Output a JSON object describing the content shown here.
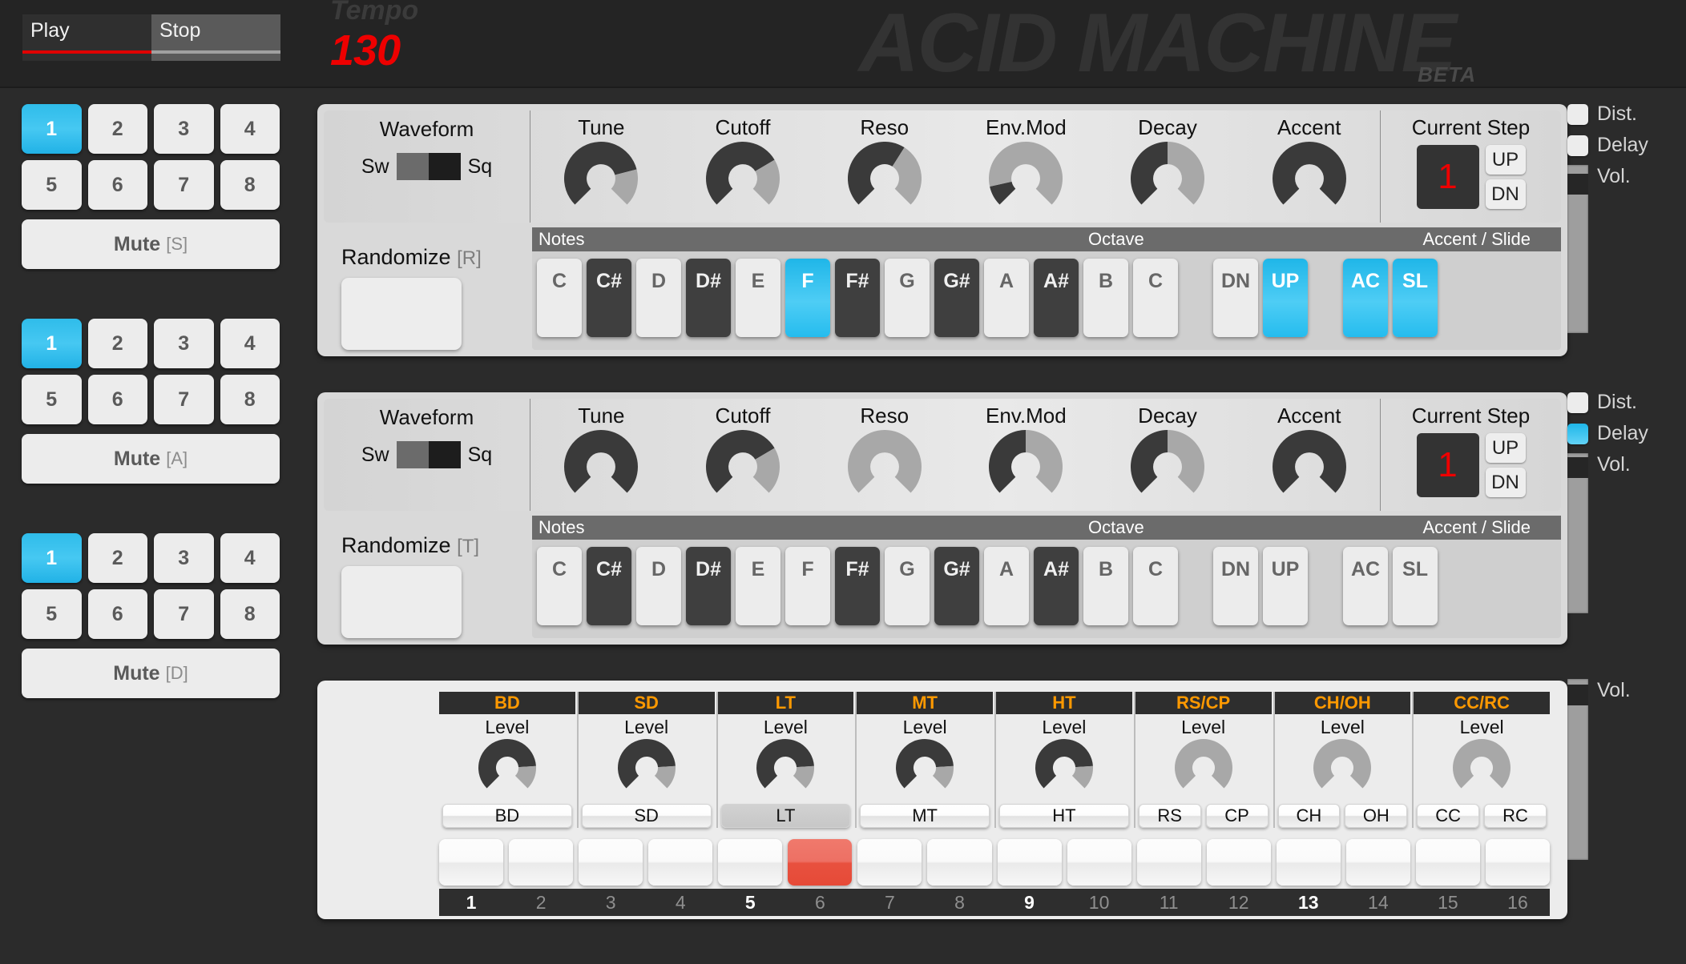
{
  "header": {
    "logo": "ACID MACHINE",
    "beta": "BETA",
    "play_label": "Play",
    "stop_label": "Stop",
    "tempo_label": "Tempo",
    "tempo_value": "130"
  },
  "colors": {
    "accent_blue": "#21b6e8",
    "accent_red": "#ee0000",
    "track_orange": "#ff9900",
    "step_red": "#e8513f"
  },
  "patterns": {
    "buttons": [
      "1",
      "2",
      "3",
      "4",
      "5",
      "6",
      "7",
      "8"
    ],
    "blocks": [
      {
        "active_index": 0,
        "mute_label": "Mute",
        "mute_key": "[S]"
      },
      {
        "active_index": 0,
        "mute_label": "Mute",
        "mute_key": "[A]"
      },
      {
        "active_index": 0,
        "mute_label": "Mute",
        "mute_key": "[D]"
      }
    ]
  },
  "synths": [
    {
      "waveform": {
        "title": "Waveform",
        "left_label": "Sw",
        "right_label": "Sq",
        "value": "Sq"
      },
      "knobs": [
        {
          "label": "Tune",
          "value": 78
        },
        {
          "label": "Cutoff",
          "value": 72
        },
        {
          "label": "Reso",
          "value": 62
        },
        {
          "label": "Env.Mod",
          "value": 12
        },
        {
          "label": "Decay",
          "value": 50
        },
        {
          "label": "Accent",
          "value": 100
        }
      ],
      "current_step": {
        "title": "Current Step",
        "value": "1",
        "up_label": "UP",
        "down_label": "DN"
      },
      "randomize": {
        "label": "Randomize",
        "key": "[R]"
      },
      "notes_header": {
        "notes": "Notes",
        "octave": "Octave",
        "accent": "Accent / Slide"
      },
      "keys": [
        {
          "name": "C",
          "type": "white",
          "on": false
        },
        {
          "name": "C#",
          "type": "black",
          "on": false
        },
        {
          "name": "D",
          "type": "white",
          "on": false
        },
        {
          "name": "D#",
          "type": "black",
          "on": false
        },
        {
          "name": "E",
          "type": "white",
          "on": false
        },
        {
          "name": "F",
          "type": "white",
          "on": true
        },
        {
          "name": "F#",
          "type": "black",
          "on": false
        },
        {
          "name": "G",
          "type": "white",
          "on": false
        },
        {
          "name": "G#",
          "type": "black",
          "on": false
        },
        {
          "name": "A",
          "type": "white",
          "on": false
        },
        {
          "name": "A#",
          "type": "black",
          "on": false
        },
        {
          "name": "B",
          "type": "white",
          "on": false
        },
        {
          "name": "C",
          "type": "white",
          "on": false
        }
      ],
      "octave": [
        {
          "name": "DN",
          "on": false
        },
        {
          "name": "UP",
          "on": true
        }
      ],
      "accent_slide": [
        {
          "name": "AC",
          "on": true
        },
        {
          "name": "SL",
          "on": true
        }
      ],
      "fx": {
        "dist_label": "Dist.",
        "dist_on": false,
        "delay_label": "Delay",
        "delay_on": false,
        "vol_label": "Vol.",
        "vol": 88
      }
    },
    {
      "waveform": {
        "title": "Waveform",
        "left_label": "Sw",
        "right_label": "Sq",
        "value": "Sq"
      },
      "knobs": [
        {
          "label": "Tune",
          "value": 100
        },
        {
          "label": "Cutoff",
          "value": 72
        },
        {
          "label": "Reso",
          "value": 0
        },
        {
          "label": "Env.Mod",
          "value": 50
        },
        {
          "label": "Decay",
          "value": 50
        },
        {
          "label": "Accent",
          "value": 100
        }
      ],
      "current_step": {
        "title": "Current Step",
        "value": "1",
        "up_label": "UP",
        "down_label": "DN"
      },
      "randomize": {
        "label": "Randomize",
        "key": "[T]"
      },
      "notes_header": {
        "notes": "Notes",
        "octave": "Octave",
        "accent": "Accent / Slide"
      },
      "keys": [
        {
          "name": "C",
          "type": "white",
          "on": false
        },
        {
          "name": "C#",
          "type": "black",
          "on": false
        },
        {
          "name": "D",
          "type": "white",
          "on": false
        },
        {
          "name": "D#",
          "type": "black",
          "on": false
        },
        {
          "name": "E",
          "type": "white",
          "on": false
        },
        {
          "name": "F",
          "type": "white",
          "on": false
        },
        {
          "name": "F#",
          "type": "black",
          "on": false
        },
        {
          "name": "G",
          "type": "white",
          "on": false
        },
        {
          "name": "G#",
          "type": "black",
          "on": false
        },
        {
          "name": "A",
          "type": "white",
          "on": false
        },
        {
          "name": "A#",
          "type": "black",
          "on": false
        },
        {
          "name": "B",
          "type": "white",
          "on": false
        },
        {
          "name": "C",
          "type": "white",
          "on": false
        }
      ],
      "octave": [
        {
          "name": "DN",
          "on": false
        },
        {
          "name": "UP",
          "on": false
        }
      ],
      "accent_slide": [
        {
          "name": "AC",
          "on": false
        },
        {
          "name": "SL",
          "on": false
        }
      ],
      "fx": {
        "dist_label": "Dist.",
        "dist_on": false,
        "delay_label": "Delay",
        "delay_on": true,
        "vol_label": "Vol.",
        "vol": 95
      }
    }
  ],
  "drum": {
    "level_label": "Level",
    "tracks": [
      {
        "name": "BD",
        "level": 82,
        "trigs": [
          {
            "label": "BD",
            "selected": false
          }
        ]
      },
      {
        "name": "SD",
        "level": 82,
        "trigs": [
          {
            "label": "SD",
            "selected": false
          }
        ]
      },
      {
        "name": "LT",
        "level": 82,
        "trigs": [
          {
            "label": "LT",
            "selected": true
          }
        ]
      },
      {
        "name": "MT",
        "level": 82,
        "trigs": [
          {
            "label": "MT",
            "selected": false
          }
        ]
      },
      {
        "name": "HT",
        "level": 82,
        "trigs": [
          {
            "label": "HT",
            "selected": false
          }
        ]
      },
      {
        "name": "RS/CP",
        "level": 0,
        "trigs": [
          {
            "label": "RS",
            "selected": false
          },
          {
            "label": "CP",
            "selected": false
          }
        ]
      },
      {
        "name": "CH/OH",
        "level": 0,
        "trigs": [
          {
            "label": "CH",
            "selected": false
          },
          {
            "label": "OH",
            "selected": false
          }
        ]
      },
      {
        "name": "CC/RC",
        "level": 0,
        "trigs": [
          {
            "label": "CC",
            "selected": false
          },
          {
            "label": "RC",
            "selected": false
          }
        ]
      }
    ],
    "steps": [
      {
        "num": "1",
        "on": false,
        "beat": true
      },
      {
        "num": "2",
        "on": false,
        "beat": false
      },
      {
        "num": "3",
        "on": false,
        "beat": false
      },
      {
        "num": "4",
        "on": false,
        "beat": false
      },
      {
        "num": "5",
        "on": false,
        "beat": true
      },
      {
        "num": "6",
        "on": true,
        "beat": false
      },
      {
        "num": "7",
        "on": false,
        "beat": false
      },
      {
        "num": "8",
        "on": false,
        "beat": false
      },
      {
        "num": "9",
        "on": false,
        "beat": true
      },
      {
        "num": "10",
        "on": false,
        "beat": false
      },
      {
        "num": "11",
        "on": false,
        "beat": false
      },
      {
        "num": "12",
        "on": false,
        "beat": false
      },
      {
        "num": "13",
        "on": false,
        "beat": true
      },
      {
        "num": "14",
        "on": false,
        "beat": false
      },
      {
        "num": "15",
        "on": false,
        "beat": false
      },
      {
        "num": "16",
        "on": false,
        "beat": false
      }
    ],
    "fx": {
      "vol_label": "Vol.",
      "vol": 92
    }
  }
}
